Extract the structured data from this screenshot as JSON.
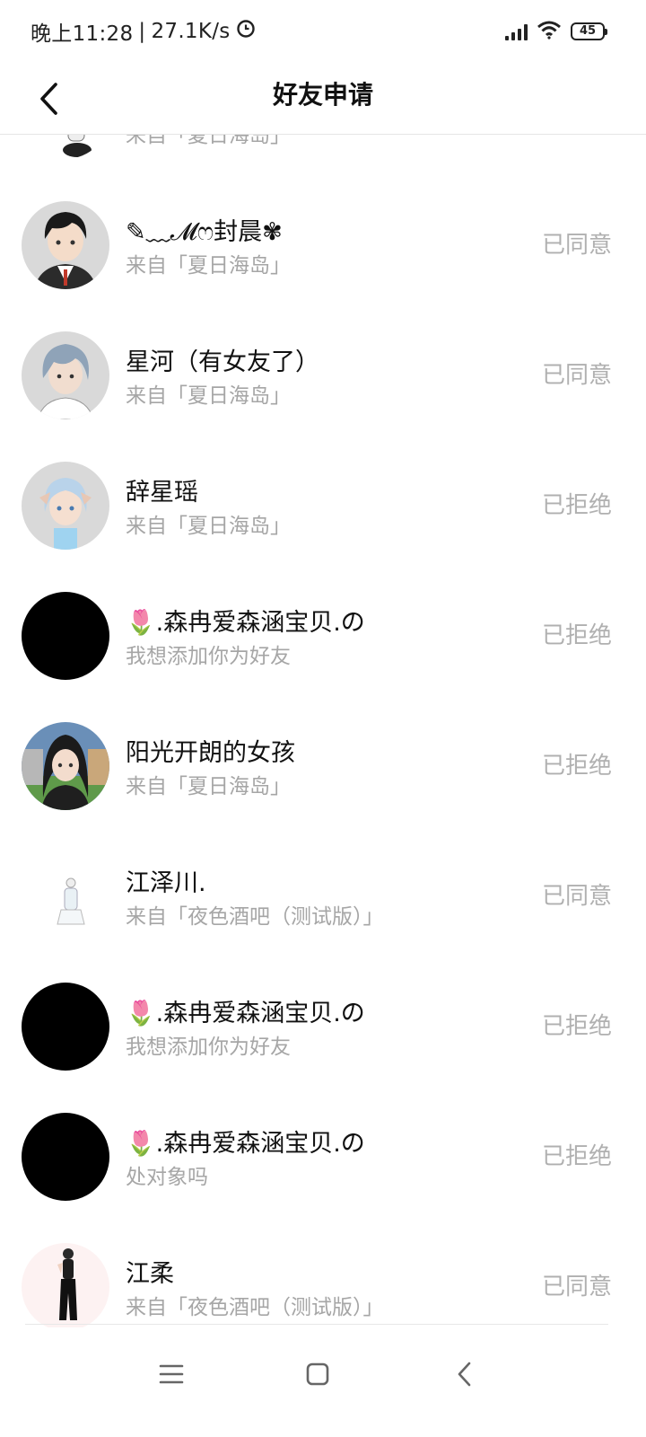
{
  "status_bar": {
    "time": "晚上11:28",
    "separator": "|",
    "speed": "27.1K/s",
    "battery": "45"
  },
  "header": {
    "title": "好友申请",
    "back_icon": "back-arrow-icon"
  },
  "requests": [
    {
      "name": "",
      "source": "来自「夏日海岛」",
      "status": "",
      "avatar": "cartoon-avatar"
    },
    {
      "name": "✎﹏𝓜ෆ封晨✾",
      "source": "来自「夏日海岛」",
      "status": "已同意",
      "avatar": "cartoon-avatar"
    },
    {
      "name": "星河（有女友了）",
      "source": "来自「夏日海岛」",
      "status": "已同意",
      "avatar": "cartoon-avatar"
    },
    {
      "name": "辞星瑶",
      "source": "来自「夏日海岛」",
      "status": "已拒绝",
      "avatar": "cartoon-avatar"
    },
    {
      "name": "🌷.森冉爱森涵宝贝.の",
      "source": "我想添加你为好友",
      "status": "已拒绝",
      "avatar": "black-avatar"
    },
    {
      "name": "阳光开朗的女孩",
      "source": "来自「夏日海岛」",
      "status": "已拒绝",
      "avatar": "cartoon-avatar"
    },
    {
      "name": "江泽川.",
      "source": "来自「夜色酒吧（测试版）」",
      "status": "已同意",
      "avatar": "cartoon-avatar"
    },
    {
      "name": "🌷.森冉爱森涵宝贝.の",
      "source": "我想添加你为好友",
      "status": "已拒绝",
      "avatar": "black-avatar"
    },
    {
      "name": "🌷.森冉爱森涵宝贝.の",
      "source": "处对象吗",
      "status": "已拒绝",
      "avatar": "black-avatar"
    },
    {
      "name": "江柔",
      "source": "来自「夜色酒吧（测试版）」",
      "status": "已同意",
      "avatar": "cartoon-avatar"
    }
  ],
  "nav": {
    "menu_icon": "menu-icon",
    "home_icon": "home-square-icon",
    "back_icon": "back-chevron-icon"
  }
}
